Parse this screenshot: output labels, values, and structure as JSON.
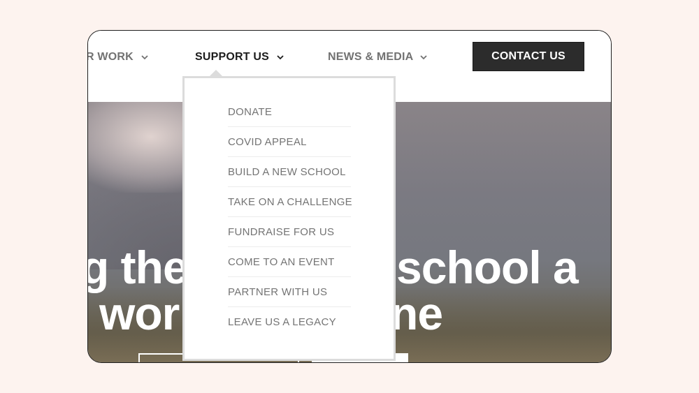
{
  "nav": {
    "items": [
      {
        "label": "R WORK",
        "active": false
      },
      {
        "label": "SUPPORT US",
        "active": true
      },
      {
        "label": "NEWS & MEDIA",
        "active": false
      }
    ],
    "chevron_icon": "chevron-down-icon",
    "contact_label": "CONTACT US"
  },
  "dropdown": {
    "items": [
      "DONATE",
      "COVID APPEAL",
      "BUILD A NEW SCHOOL",
      "TAKE ON A CHALLENGE",
      "FUNDRAISE FOR US",
      "COME TO AN EVENT",
      "PARTNER WITH US",
      "LEAVE US A LEGACY"
    ]
  },
  "hero": {
    "line1_left": "g the",
    "line1_right": "school a",
    "line2_left": "wor",
    "line2_right": "ne"
  },
  "colors": {
    "page_bg": "#fdf3ef",
    "button_bg": "#2c2c2c",
    "nav_text": "#727272",
    "nav_active": "#1c1c1c",
    "menu_text": "#747474"
  }
}
